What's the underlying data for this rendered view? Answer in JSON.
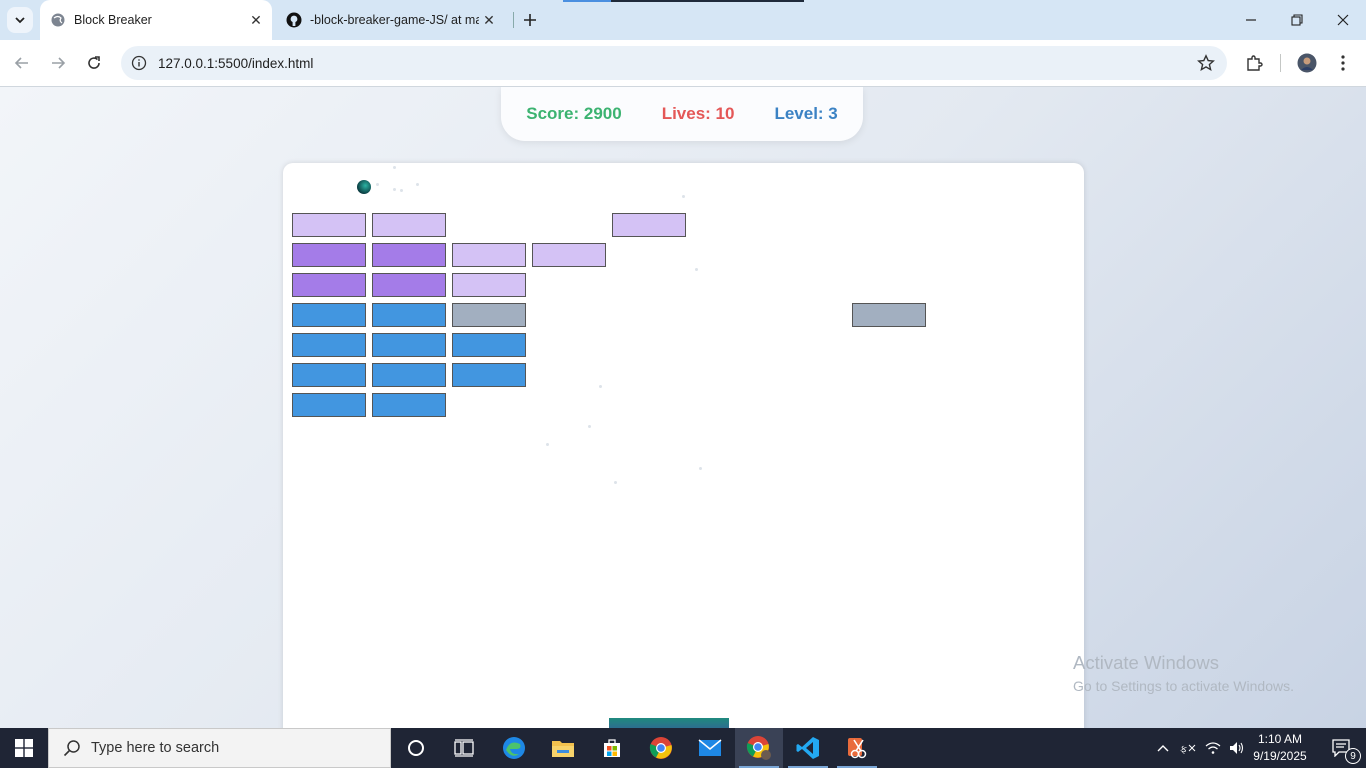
{
  "browser": {
    "tabs": [
      {
        "title": "Block Breaker",
        "active": true
      },
      {
        "title": "-block-breaker-game-JS/ at ma",
        "active": false
      }
    ],
    "url": "127.0.0.1:5500/index.html"
  },
  "game": {
    "score_text": "Score: 2900",
    "lives_text": "Lives: 10",
    "level_text": "Level: 3",
    "score_color": "#3cb371",
    "lives_color": "#e45757",
    "level_color": "#3b82c4",
    "brick_colors": {
      "light_purple": "#d4c2f5",
      "purple": "#a47ce8",
      "blue": "#4296e0",
      "gray": "#a2afc0"
    }
  },
  "watermark": {
    "line1": "Activate Windows",
    "line2": "Go to Settings to activate Windows."
  },
  "taskbar": {
    "search_placeholder": "Type here to search",
    "time": "1:10 AM",
    "date": "9/19/2025",
    "notification_count": "9"
  }
}
